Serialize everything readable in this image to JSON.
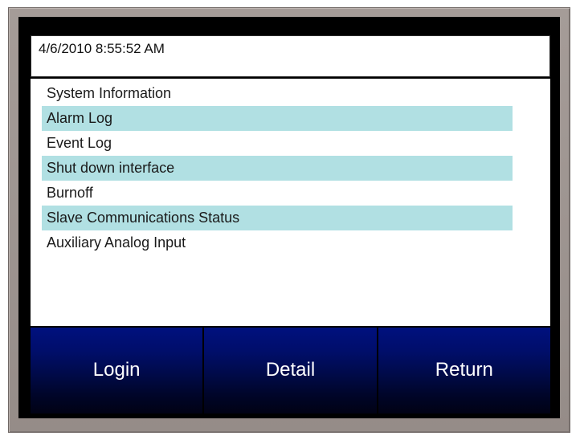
{
  "header": {
    "timestamp": "4/6/2010 8:55:52 AM"
  },
  "menu": {
    "items": [
      {
        "label": "System Information",
        "highlighted": false
      },
      {
        "label": "Alarm Log",
        "highlighted": true
      },
      {
        "label": "Event Log",
        "highlighted": false
      },
      {
        "label": "Shut down interface",
        "highlighted": true
      },
      {
        "label": "Burnoff",
        "highlighted": false
      },
      {
        "label": "Slave Communications Status",
        "highlighted": true
      },
      {
        "label": "Auxiliary Analog Input",
        "highlighted": false
      }
    ]
  },
  "buttons": {
    "login": "Login",
    "detail": "Detail",
    "return": "Return"
  },
  "colors": {
    "bezel": "#a09894",
    "screen_background": "#000000",
    "row_highlight": "#b1e0e3",
    "button_top": "#00107e",
    "button_bottom": "#010214",
    "button_text": "#ffffff"
  }
}
